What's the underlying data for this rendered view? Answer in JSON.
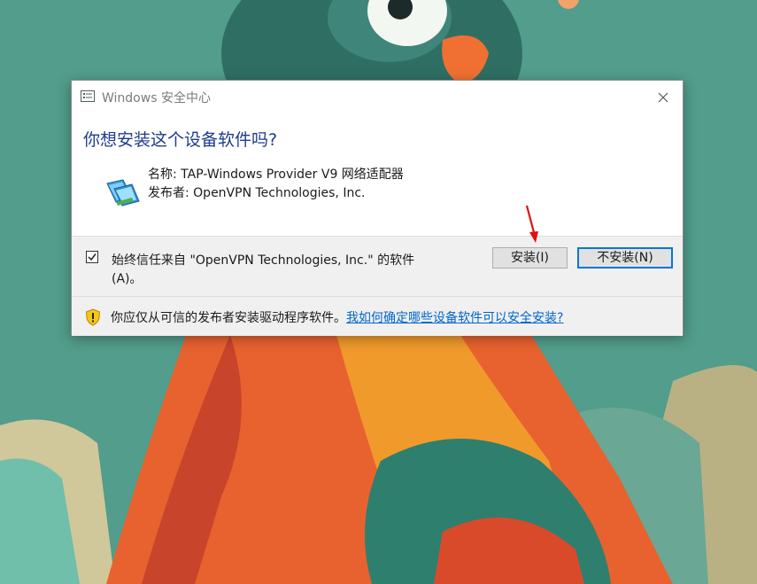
{
  "dialog": {
    "title": "Windows 安全中心",
    "heading": "你想安装这个设备软件吗?",
    "device": {
      "name_label": "名称: TAP-Windows Provider V9 网络适配器",
      "publisher_label": "发布者: OpenVPN Technologies, Inc."
    },
    "trust": {
      "checked": true,
      "text": "始终信任来自 \"OpenVPN Technologies, Inc.\" 的软件(A)。"
    },
    "buttons": {
      "install": "安装(I)",
      "no_install": "不安装(N)"
    },
    "footer": {
      "text": "你应仅从可信的发布者安装驱动程序软件。",
      "link": "我如何确定哪些设备软件可以安全安装?"
    }
  },
  "colors": {
    "heading": "#1e3c8c",
    "link": "#0066cc",
    "wallpaper": "#4f9a87",
    "annotation_arrow": "#e01010"
  }
}
